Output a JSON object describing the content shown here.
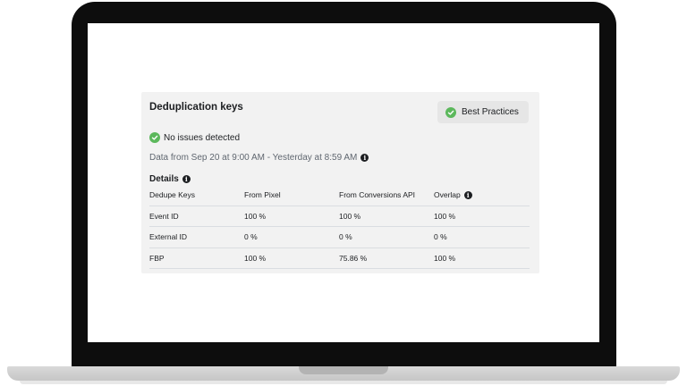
{
  "card": {
    "title": "Deduplication keys",
    "best_practices_label": "Best Practices",
    "status_text": "No issues detected",
    "date_range": "Data from Sep 20 at 9:00 AM - Yesterday at 8:59 AM",
    "details_label": "Details"
  },
  "table": {
    "headers": [
      "Dedupe Keys",
      "From Pixel",
      "From Conversions API",
      "Overlap"
    ],
    "rows": [
      [
        "Event ID",
        "100 %",
        "100 %",
        "100 %"
      ],
      [
        "External ID",
        "0 %",
        "0 %",
        "0 %"
      ],
      [
        "FBP",
        "100 %",
        "75.86 %",
        "100 %"
      ]
    ]
  },
  "colors": {
    "success": "#5cb85c",
    "card_bg": "#f2f2f2",
    "button_bg": "#e6e6e6",
    "bezel": "#0d0d0d"
  },
  "icons": {
    "status": "check-circle-icon",
    "info": "info-icon"
  }
}
